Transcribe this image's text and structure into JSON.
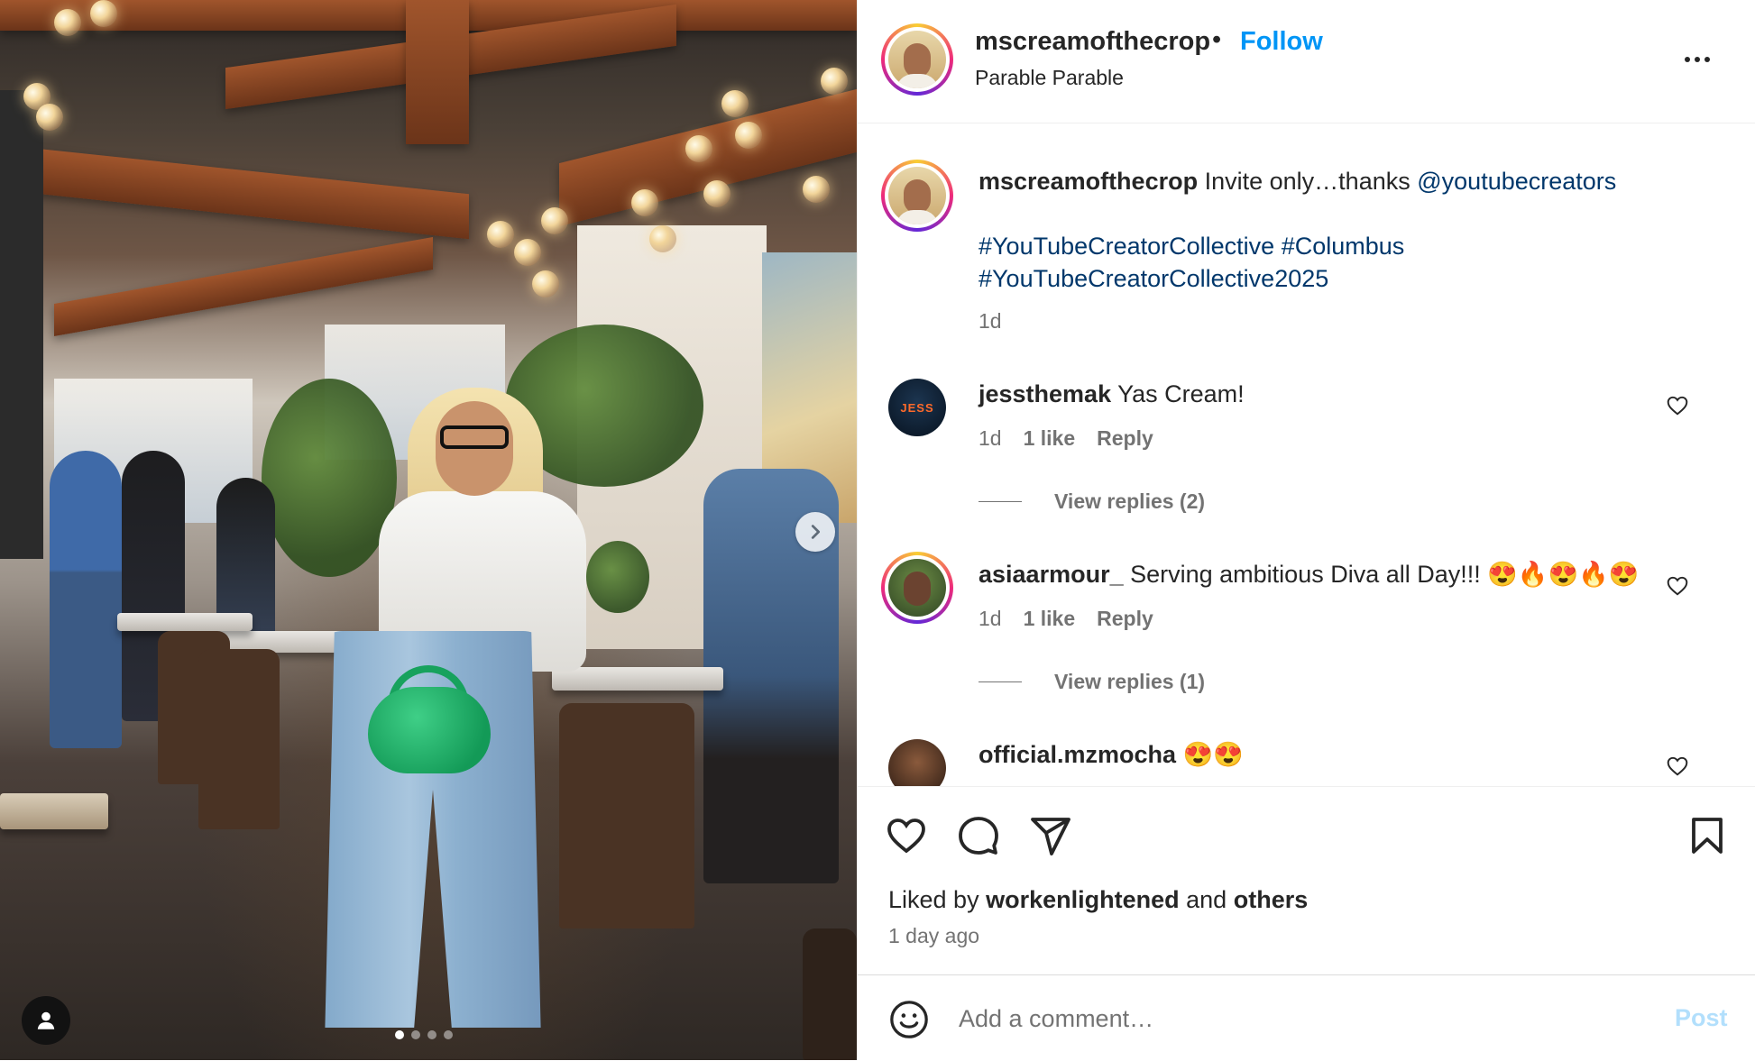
{
  "post": {
    "username": "mscreamofthecrop",
    "separator": "•",
    "follow_label": "Follow",
    "audio": "Parable Parable",
    "more_icon": "more-horizontal-icon"
  },
  "caption": {
    "username": "mscreamofthecrop",
    "text": "Invite only…thanks",
    "mention": "@youtubecreators",
    "hashtag1": "#YouTubeCreatorCollective",
    "hashtag2": "#Columbus",
    "hashtag3": "#YouTubeCreatorCollective2025",
    "time": "1d"
  },
  "comments": [
    {
      "username": "jessthemak",
      "text": "Yas Cream!",
      "time": "1d",
      "likes": "1 like",
      "reply_label": "Reply",
      "view_replies": "View replies (2)",
      "avatar_text": "JESS"
    },
    {
      "username": "asiaarmour_",
      "text": "Serving ambitious Diva all Day!!! 😍🔥😍🔥😍",
      "time": "1d",
      "likes": "1 like",
      "reply_label": "Reply",
      "view_replies": "View replies (1)"
    },
    {
      "username": "official.mzmocha",
      "text": "😍😍"
    }
  ],
  "footer": {
    "liked_prefix": "Liked by",
    "liked_user": "workenlightened",
    "liked_and": "and",
    "liked_others": "others",
    "time_ago": "1 day ago"
  },
  "comment_box": {
    "placeholder": "Add a comment…",
    "post_label": "Post"
  },
  "carousel": {
    "slide_count": 4,
    "active_index": 0
  },
  "colors": {
    "follow": "#0095f6",
    "link": "#00376b",
    "post_disabled": "#b2dffc",
    "muted": "#737373"
  }
}
